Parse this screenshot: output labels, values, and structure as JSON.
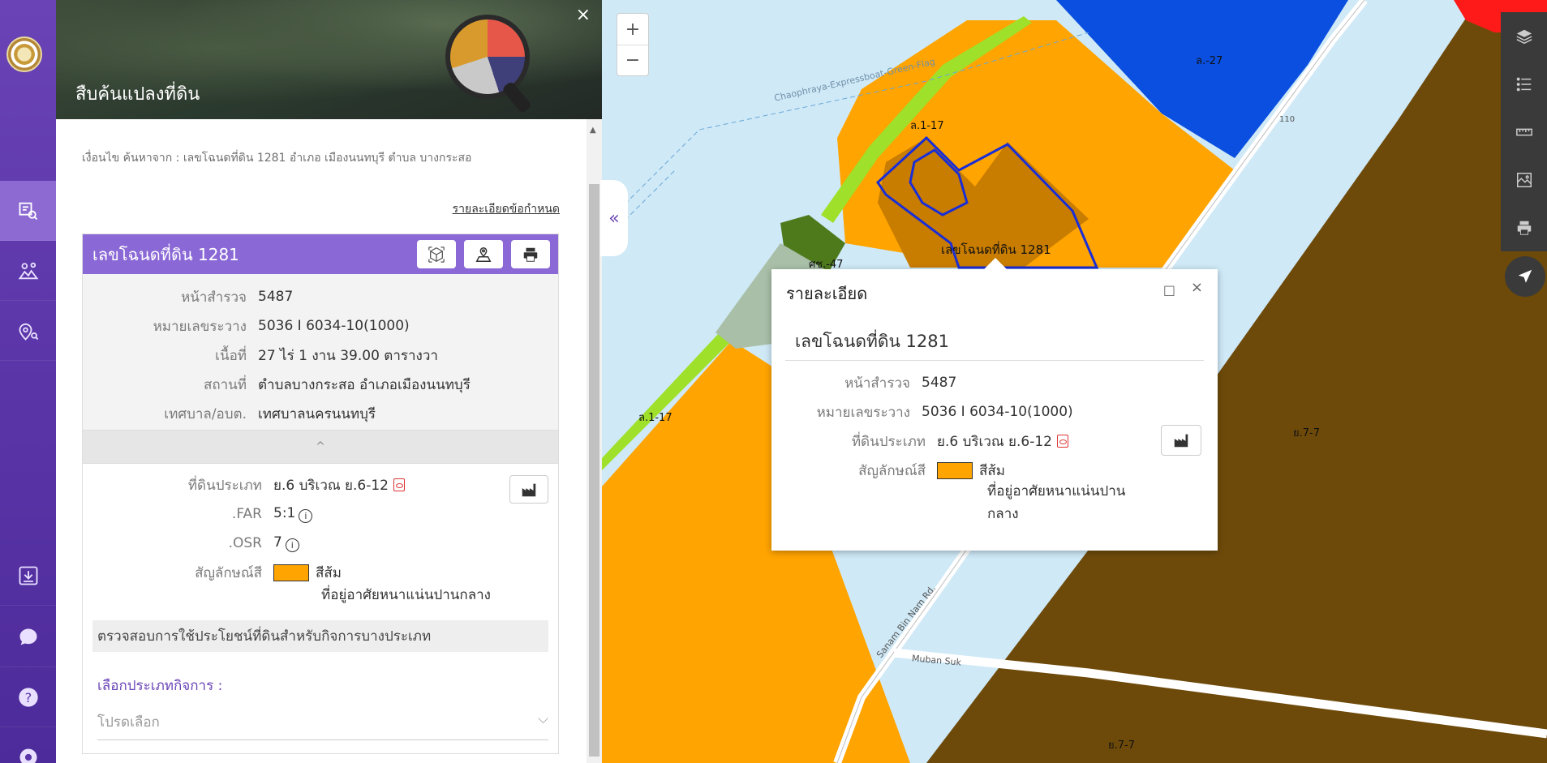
{
  "panel": {
    "title": "สืบค้นแปลงที่ดิน",
    "close": "×",
    "search_result": "เงื่อนไข ค้นหาจาก : เลขโฉนดที่ดิน 1281 อำเภอ เมืองนนทบุรี ตำบล บางกระสอ",
    "terms_link": "รายละเอียดข้อกำหนด",
    "card": {
      "title": "เลขโฉนดที่ดิน 1281",
      "info": [
        {
          "k": "หน้าสำรวจ",
          "v": "5487"
        },
        {
          "k": "หมายเลขระวาง",
          "v": "5036 I 6034-10(1000)"
        },
        {
          "k": "เนื้อที่",
          "v": "27 ไร่ 1 งาน 39.00 ตารางวา"
        },
        {
          "k": "สถานที่",
          "v": "ตำบลบางกระสอ อำเภอเมืองนนทบุรี"
        },
        {
          "k": "เทศบาล/อบต.",
          "v": "เทศบาลนครนนทบุรี"
        }
      ],
      "collapse_icon": "^",
      "zone": {
        "type_label": "ที่ดินประเภท",
        "type_value": "ย.6 บริเวณ ย.6-12",
        "far_label": ".FAR",
        "far_value": "5:1",
        "osr_label": ".OSR",
        "osr_value": "7",
        "symbol_label": "สัญลักษณ์สี",
        "symbol_color_name": "สีส้ม",
        "symbol_desc": "ที่อยู่อาศัยหนาแน่นปานกลาง",
        "symbol_color": "#ffa400"
      },
      "check_bar": "ตรวจสอบการใช้ประโยชน์ที่ดินสำหรับกิจการบางประเภท",
      "select_label": "เลือกประเภทกิจการ :",
      "select_placeholder": "โปรดเลือก"
    }
  },
  "toggle": "«",
  "map": {
    "zoom_in": "+",
    "zoom_out": "−",
    "labels": {
      "l1": "ล.-27",
      "l2": "ล.1-17",
      "l3": "ศช.-47",
      "l4": "ล.1-17",
      "l5": "ย.7-7",
      "l6": "ย.7-7",
      "l7": "เลขโฉนดที่ดิน 1281",
      "road1": "Chaophraya-Expressboat-Green-Flag",
      "road2": "Sanam Bin Nam Rd.",
      "road3": "Muban Suk",
      "road4": "110"
    }
  },
  "popup": {
    "title": "รายละเอียด",
    "maximize": "□",
    "close": "×",
    "sub": "เลขโฉนดที่ดิน 1281",
    "rows": [
      {
        "k": "หน้าสำรวจ",
        "v": "5487"
      },
      {
        "k": "หมายเลขระวาง",
        "v": "5036 I 6034-10(1000)"
      }
    ],
    "type_label": "ที่ดินประเภท",
    "type_value": "ย.6 บริเวณ ย.6-12",
    "symbol_label": "สัญลักษณ์สี",
    "symbol_color_name": "สีส้ม",
    "symbol_desc_1": "ที่อยู่อาศัยหนาแน่นปาน",
    "symbol_desc_2": "กลาง"
  },
  "colors": {
    "accent": "#8a68d6",
    "rail": "#5a35a8",
    "orange_zone": "#ffa400",
    "brown_zone": "#6e4a0a",
    "blue_zone": "#0a4fe0",
    "river": "#cfe9f7"
  }
}
